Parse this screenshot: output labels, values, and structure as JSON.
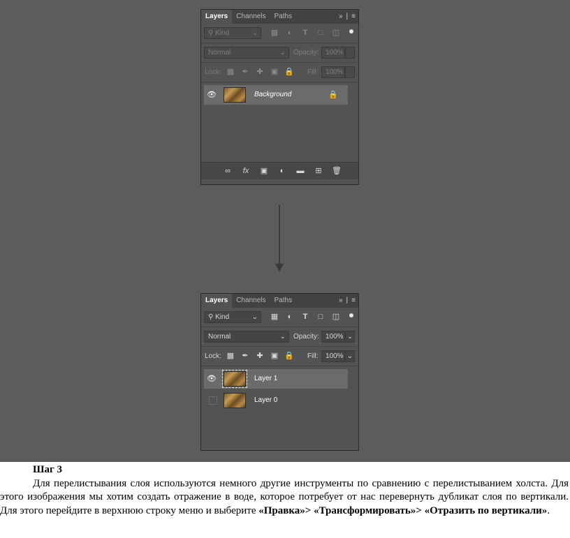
{
  "panel_before": {
    "tabs": [
      "Layers",
      "Channels",
      "Paths"
    ],
    "filter_kind": "Kind",
    "blend_mode": "Normal",
    "opacity_label": "Opacity:",
    "opacity_value": "100%",
    "lock_label": "Lock:",
    "fill_label": "Fill:",
    "fill_value": "100%",
    "layers": [
      {
        "name": "Background",
        "visible": true,
        "locked": true,
        "selected": true
      }
    ]
  },
  "panel_after": {
    "tabs": [
      "Layers",
      "Channels",
      "Paths"
    ],
    "filter_kind": "Kind",
    "blend_mode": "Normal",
    "opacity_label": "Opacity:",
    "opacity_value": "100%",
    "lock_label": "Lock:",
    "fill_label": "Fill:",
    "fill_value": "100%",
    "layers": [
      {
        "name": "Layer 1",
        "visible": true,
        "selected": true
      },
      {
        "name": "Layer 0",
        "visible": false,
        "selected": false
      }
    ]
  },
  "icons": {
    "search": "search-icon",
    "eye": "eye-icon",
    "lock": "lock-icon",
    "arrow": "arrow-down-icon"
  },
  "colors": {
    "canvas": "#5c5c5c",
    "panel": "#535353",
    "selected_row": "#6b6b6b"
  },
  "text": {
    "step_title": "Шаг 3",
    "para_main": "Для перелистывания слоя используются немного другие инструменты по сравнению с перелистыванием холста. Для этого изображения мы хотим создать отражение в воде, которое потребует от нас перевернуть дубликат слоя по вертикали. Для этого перейдите в верхнюю строку меню и выберите ",
    "menu_edit": "«Правка»",
    "sep1": "> ",
    "menu_transform": "«Трансформировать»",
    "sep2": "> ",
    "menu_flip": "«Отразить по вертикали»",
    "end": "."
  }
}
